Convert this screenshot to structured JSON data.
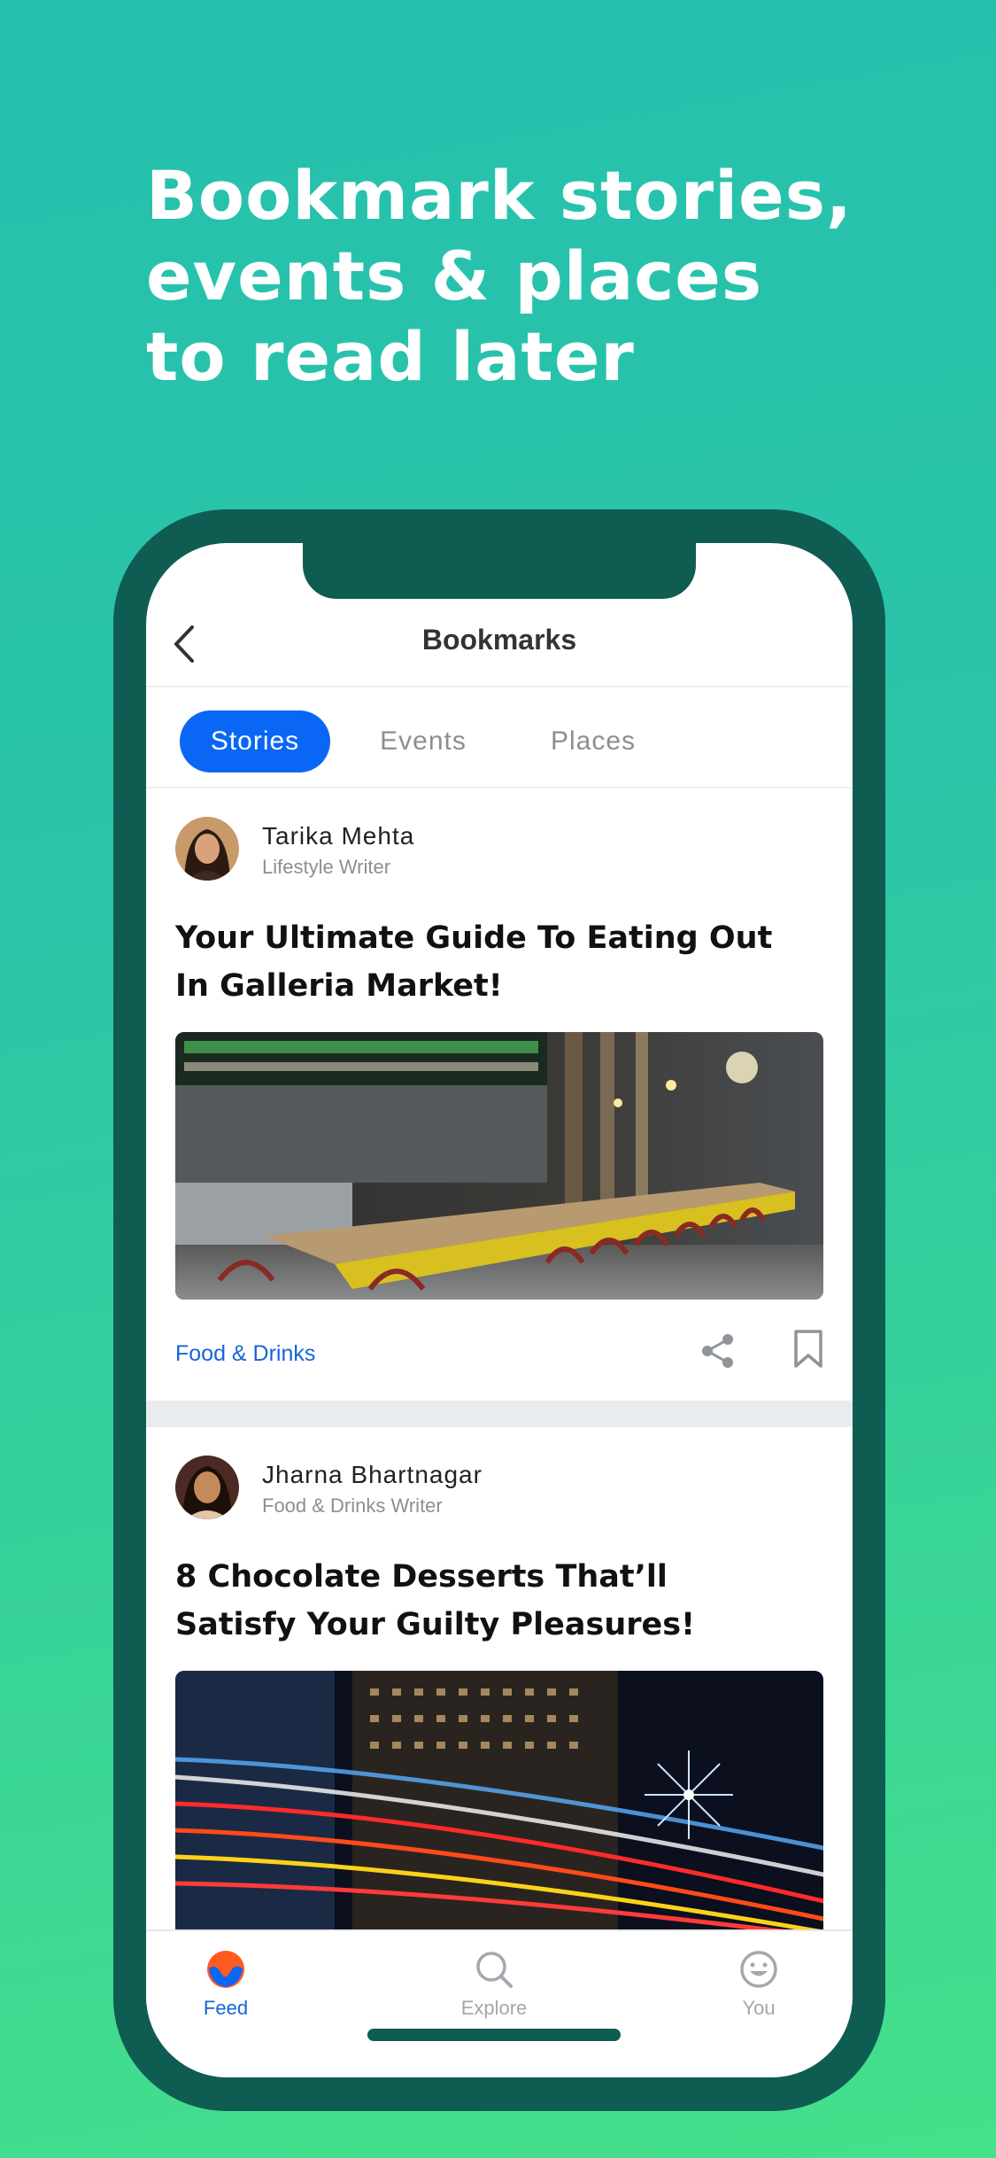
{
  "headline": {
    "line1": "Bookmark stories,",
    "line2": "events & places",
    "line3": "to read later"
  },
  "colors": {
    "background_gradient": [
      "#25c0ae",
      "#45e08a"
    ],
    "phone_frame": "#0f5c52",
    "accent_blue": "#0a66f5",
    "link_blue": "#1565d8",
    "feed_icon_orange": "#ff5a1f"
  },
  "navbar": {
    "back_icon": "chevron-left-icon",
    "title": "Bookmarks"
  },
  "tabs": [
    {
      "label": "Stories",
      "active": true
    },
    {
      "label": "Events",
      "active": false
    },
    {
      "label": "Places",
      "active": false
    }
  ],
  "stories": [
    {
      "author": "Tarika Mehta",
      "role": "Lifestyle Writer",
      "title_line1": "Your Ultimate Guide To Eating Out",
      "title_line2": "In Galleria Market!",
      "image": "restaurant-bar-photo",
      "category": "Food & Drinks",
      "share_icon": "share-icon",
      "bookmark_icon": "bookmark-icon"
    },
    {
      "author": "Jharna Bhartnagar",
      "role": "Food & Drinks Writer",
      "title_line1": "8 Chocolate Desserts That’ll",
      "title_line2": "Satisfy Your Guilty Pleasures!",
      "image": "city-night-light-trails-photo"
    }
  ],
  "tabbar": [
    {
      "label": "Feed",
      "icon": "feed-logo-icon",
      "active": true
    },
    {
      "label": "Explore",
      "icon": "search-icon",
      "active": false
    },
    {
      "label": "You",
      "icon": "smiley-face-icon",
      "active": false
    }
  ]
}
